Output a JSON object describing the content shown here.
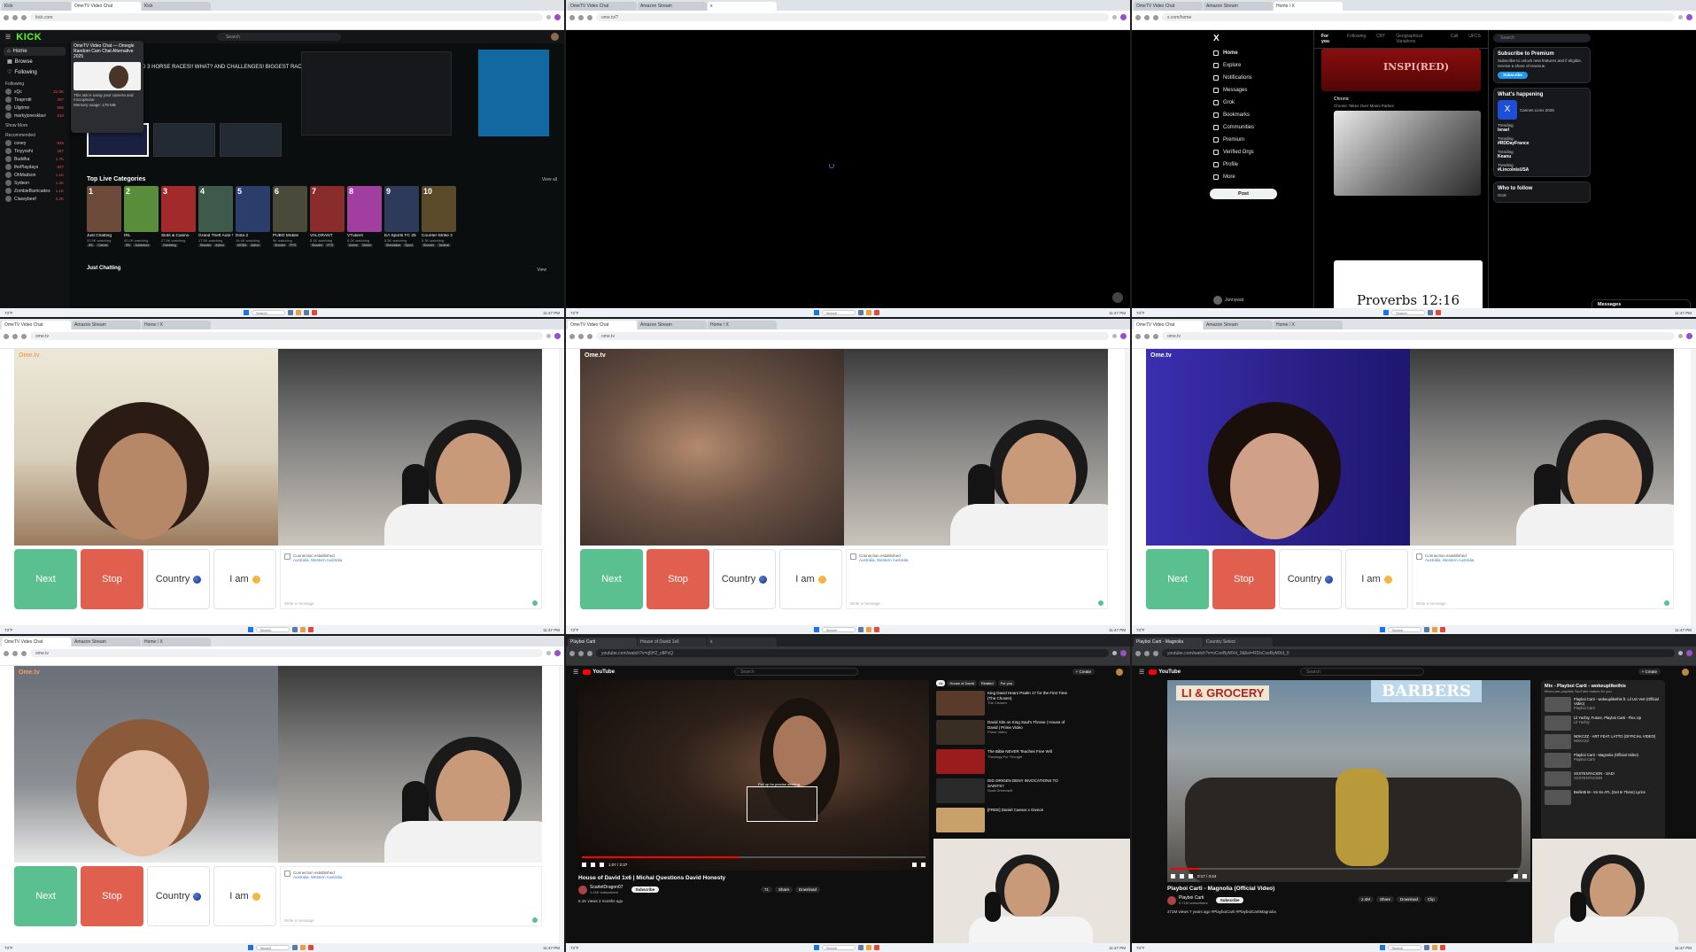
{
  "colors": {
    "kick_green": "#53fc18",
    "ome_next": "#5bc08f",
    "ome_stop": "#e15f4f",
    "youtube_red": "#ff0000",
    "x_blue": "#1d9bf0"
  },
  "taskbar": {
    "search": "Search",
    "weather": "73°F",
    "clock": "11:47 PM"
  },
  "panes": {
    "kick": {
      "tabs": [
        "Kick",
        "OmeTV Video Chat",
        "Kick"
      ],
      "url": "kick.com",
      "logo": "KICK",
      "search_placeholder": "Search",
      "nav": [
        "Home",
        "Browse",
        "Following"
      ],
      "following_header": "Following",
      "recommended_header": "Recommended",
      "show_more": "Show More",
      "channels_following": [
        {
          "name": "xQc",
          "viewers": "22.5K"
        },
        {
          "name": "Tiraprotti",
          "viewers": "287"
        },
        {
          "name": "Ulgrime",
          "viewers": "895"
        },
        {
          "name": "markyjonesklavi",
          "viewers": "810"
        }
      ],
      "channels_recommended": [
        {
          "name": "cooey",
          "viewers": "845"
        },
        {
          "name": "Tinyyoshi",
          "viewers": "287"
        },
        {
          "name": "Buddha",
          "viewers": "1.7K"
        },
        {
          "name": "thePlaydays",
          "viewers": "847"
        },
        {
          "name": "OhMadson",
          "viewers": "1.1K"
        },
        {
          "name": "Sydeon",
          "viewers": "1.4K"
        },
        {
          "name": "ZombieBarricades",
          "viewers": "1.1K"
        },
        {
          "name": "Classybeef",
          "viewers": "2.2K"
        }
      ],
      "popup": {
        "title": "OmeTV Video Chat — Omegle Random Cam Chat Alternative 2025",
        "line1": "This tab is using your camera and microphone",
        "line2": "Memory usage: 178 MB"
      },
      "hero_text": "...GULT AND 3 HORSE RACES!! WHAT? AND CHALLENGES! BIGGEST RACE EVA - $100,000!!",
      "top_live_title": "Top Live Categories",
      "view_all": "View all",
      "categories": [
        {
          "num": "1",
          "name": "Just Chatting",
          "sub": "33.9K watching",
          "color": "#6d4b3b",
          "tags": [
            "IRL",
            "Casual"
          ]
        },
        {
          "num": "2",
          "name": "IRL",
          "sub": "40.2K watching",
          "color": "#5a8d3a",
          "tags": [
            "IRL",
            "Adventure"
          ]
        },
        {
          "num": "3",
          "name": "Slots & Casino",
          "sub": "27.8K watching",
          "color": "#a32a2a",
          "tags": [
            "Gambling"
          ]
        },
        {
          "num": "4",
          "name": "Grand Theft Auto V",
          "sub": "17.8K watching",
          "color": "#3d5a4a",
          "tags": [
            "Shooter",
            "Action"
          ]
        },
        {
          "num": "5",
          "name": "Dota 2",
          "sub": "16.4K watching",
          "color": "#2b3e6b",
          "tags": [
            "MOBA",
            "Action"
          ]
        },
        {
          "num": "6",
          "name": "PUBG Mobile",
          "sub": "9K watching",
          "color": "#4a4a3a",
          "tags": [
            "Shooter",
            "FPS"
          ]
        },
        {
          "num": "7",
          "name": "VALORANT",
          "sub": "8.1K watching",
          "color": "#8b2c2c",
          "tags": [
            "Shooter",
            "FPS"
          ]
        },
        {
          "num": "8",
          "name": "VTubers",
          "sub": "6.3K watching",
          "color": "#a23ea0",
          "tags": [
            "Anime",
            "Vtuber"
          ]
        },
        {
          "num": "9",
          "name": "EA Sports FC 25",
          "sub": "5.5K watching",
          "color": "#2d3a5a",
          "tags": [
            "Simulation",
            "Sport"
          ]
        },
        {
          "num": "10",
          "name": "Counter-Strike 2",
          "sub": "5.3K watching",
          "color": "#5a4a2a",
          "tags": [
            "Shooter",
            "Tactical"
          ]
        }
      ],
      "just_chatting": "Just Chatting",
      "view_label": "View"
    },
    "blank": {
      "tabs": [
        "OmeTV Video Chat",
        "Amazon Stream",
        "x"
      ],
      "url": "ome.tv/?"
    },
    "x": {
      "tabs": [
        "OmeTV Video Chat",
        "Amazon Stream",
        "Home / X"
      ],
      "url": "x.com/home",
      "logo": "X",
      "nav": [
        "Home",
        "Explore",
        "Notifications",
        "Messages",
        "Grok",
        "Bookmarks",
        "Communities",
        "Premium",
        "Verified Orgs",
        "Profile",
        "More"
      ],
      "post": "Post",
      "user": "Jonnywat",
      "feed_tabs": [
        "For you",
        "Following",
        "CBT",
        "Geographical Variations",
        "Call",
        "UFCS"
      ],
      "video1_text": "INSPI(RED)",
      "tweet_author": "Chronic",
      "tweet_text": "Chronic Takes Over Miami Parties",
      "proverbs": "Proverbs 12:16",
      "search": "Search",
      "premium_title": "Subscribe to Premium",
      "premium_desc": "Subscribe to unlock new features and if eligible, receive a share of revenue.",
      "subscribe": "Subscribe",
      "happening_title": "What's happening",
      "happening_item": "Cannes Lions 2025",
      "trends": [
        {
          "name": "Israel",
          "meta": "Trending"
        },
        {
          "name": "#RDDayFrance",
          "meta": "Trending"
        },
        {
          "name": "Keanu",
          "meta": "Trending"
        },
        {
          "name": "#LincolnIsUSA",
          "meta": "Trending"
        }
      ],
      "who_to_follow": "Who to follow",
      "grok_label": "Grok",
      "messages": "Messages"
    },
    "ome1": {
      "tabs": [
        "OmeTV Video Chat",
        "Amazon Stream",
        "Home / X"
      ],
      "url": "ome.tv",
      "logo": "Ome.tv"
    },
    "ome2": {
      "tabs": [
        "OmeTV Video Chat",
        "Amazon Stream",
        "Home / X"
      ],
      "url": "ome.tv",
      "logo": "Ome.tv"
    },
    "ome3": {
      "tabs": [
        "OmeTV Video Chat",
        "Amazon Stream",
        "Home / X"
      ],
      "url": "ome.tv",
      "logo": "Ome.tv"
    },
    "ome4": {
      "tabs": [
        "OmeTV Video Chat",
        "Amazon Stream",
        "Home / X"
      ],
      "url": "ome.tv",
      "logo": "Ome.tv"
    },
    "ome_common": {
      "next": "Next",
      "stop": "Stop",
      "country": "Country",
      "iam": "I am",
      "connection": "Connection established",
      "location": "Australia, Western Australia",
      "chat_placeholder": "Write a message"
    },
    "yt1": {
      "tabs": [
        "Playboi Carti",
        "House of David 1x6",
        "x"
      ],
      "url": "youtube.com/watch?v=q5H2_v8PxQ",
      "logo": "YouTube",
      "search": "Search",
      "create": "+ Create",
      "title": "House of David 1x6 | Michal Questions David Honesty",
      "channel": "ScarletDragon07",
      "subs": "1.24K subscribers",
      "subscribe": "Subscribe",
      "views": "5.1K views  2 months ago",
      "time": "1:07 / 2:37",
      "scrub_label": "Pull up for precise seeking",
      "progress_pct": 46,
      "actions": [
        "71",
        "Share",
        "Download"
      ],
      "chips": [
        "All",
        "House of David",
        "Related",
        "For you"
      ],
      "recs": [
        {
          "title": "King David Hears Psalm 17 for the First Time (The Chosen)",
          "meta": "The Chosen",
          "color": "#5a3a2a"
        },
        {
          "title": "David Sits on King Saul's Throne | House of David | Prime Video",
          "meta": "Prime Video",
          "color": "#3a2e24"
        },
        {
          "title": "The Bible NEVER Teaches Free Will",
          "meta": "Theology For Thought",
          "color": "#9a1c1c"
        },
        {
          "title": "DID ORIGEN DENY INVOCATIONS TO SAINTS?",
          "meta": "Scott Greenwell",
          "color": "#2a2a2a"
        },
        {
          "title": "[FREE] Daniel Caesar x Giveon",
          "meta": "",
          "color": "#c8a06a"
        }
      ]
    },
    "yt2": {
      "tabs": [
        "Playboi Carti - Magnolia",
        "Country Select"
      ],
      "url": "youtube.com/watch?v=oCveByMXd_0&list=RDoCveByMXd_0",
      "logo": "YouTube",
      "search": "Search",
      "create": "+ Create",
      "title": "Playboi Carti - Magnolia (Official Video)",
      "channel": "Playboi Carti",
      "subs": "9.71M subscribers",
      "subscribe": "Subscribe",
      "views": "271M views  7 years ago  #PlayboiCarti #PlayboiCartiMagnolia",
      "time": "0:17 / 3:44",
      "progress_pct": 8,
      "actions": [
        "2.4M",
        "Share",
        "Download",
        "Clip"
      ],
      "video_sign_left": "LI & GROCERY",
      "video_sign_right": "BARBERS",
      "mix_title": "Mix - Playboi Carti - wokeuplikethis",
      "mix_sub": "Mixes are playlists YouTube makes for you",
      "mix_items": [
        {
          "title": "Playboi Carti - wokeuplikethis ft. Lil Uzi Vert (Official Video)",
          "meta": "Playboi Carti"
        },
        {
          "title": "Lil Yachty, Future, Playboi Carti - Flex Up",
          "meta": "Lil Yachty"
        },
        {
          "title": "NOKCZZ - ART FEAT. LATTO (OFFICIAL VIDEO)",
          "meta": "NOKCZZ"
        },
        {
          "title": "Playboi Carti - Magnolia (Official Video)",
          "meta": "Playboi Carti"
        },
        {
          "title": "XXXTENTACION - SAD!",
          "meta": "XXXTENTACION"
        },
        {
          "title": "Berlietti M - Im So ATL (Get In There) Lyrics",
          "meta": ""
        }
      ]
    }
  }
}
